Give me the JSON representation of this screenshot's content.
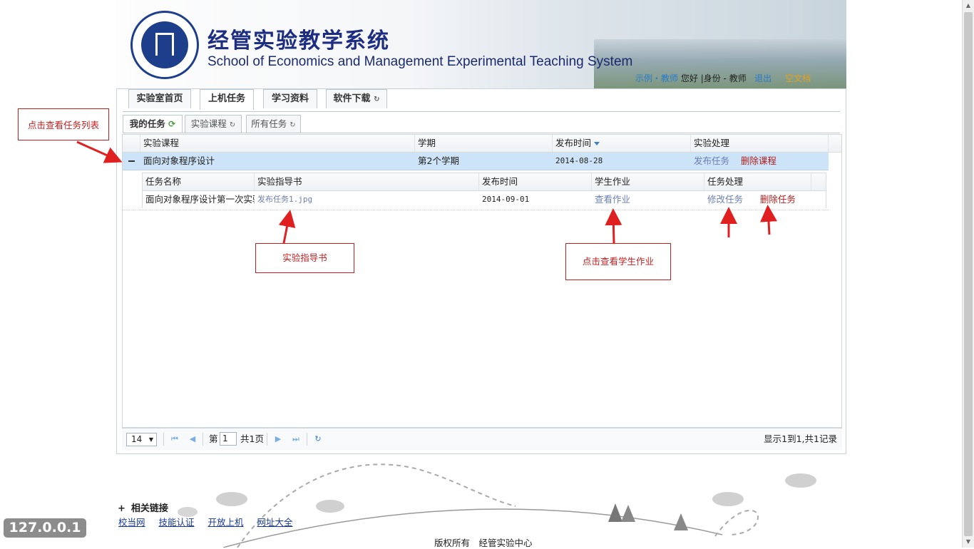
{
  "header": {
    "title_cn": "经管实验教学系统",
    "title_en": "School of Economics and Management Experimental Teaching System",
    "user_name": "示例・教师",
    "greeting": "您好",
    "identity_label": "|身份 - 教师",
    "logout": "退出",
    "extra_link": "空文档"
  },
  "tabs_main": [
    "实验室首页",
    "上机任务",
    "学习资料",
    "软件下载"
  ],
  "tabs_sub": [
    "我的任务",
    "实验课程",
    "所有任务"
  ],
  "grid": {
    "columns": [
      "实验课程",
      "学期",
      "发布时间",
      "实验处理"
    ],
    "row": {
      "course": "面向对象程序设计",
      "term": "第2个学期",
      "date": "2014-08-28",
      "publish": "发布任务",
      "delete": "删除课程"
    },
    "sub_columns": [
      "任务名称",
      "实验指导书",
      "发布时间",
      "学生作业",
      "任务处理"
    ],
    "sub_row": {
      "name": "面向对象程序设计第一次实验",
      "guide": "发布任务1.jpg",
      "date": "2014-09-01",
      "view": "查看作业",
      "edit": "修改任务",
      "delete": "删除任务"
    }
  },
  "pager": {
    "page_size": "14",
    "page_prefix": "第",
    "page_value": "1",
    "page_suffix": "共1页",
    "info": "显示1到1,共1记录"
  },
  "annotations": {
    "task_list": "点击查看任务列表",
    "guide_book": "实验指导书",
    "view_homework": "点击查看学生作业"
  },
  "footer": {
    "related_title": "相关链接",
    "plus": "+",
    "links": [
      "校当网",
      "技能认证",
      "开放上机",
      "网址大全"
    ],
    "copyright": "版权所有　经管实验中心",
    "ip": "127.0.0.1"
  },
  "colors": {
    "title_blue": "#1d2d82",
    "row_highlight": "#cde3f7",
    "annotation_red": "#c02020",
    "link_red": "#b02020",
    "link_blue": "#6b7fb3"
  }
}
